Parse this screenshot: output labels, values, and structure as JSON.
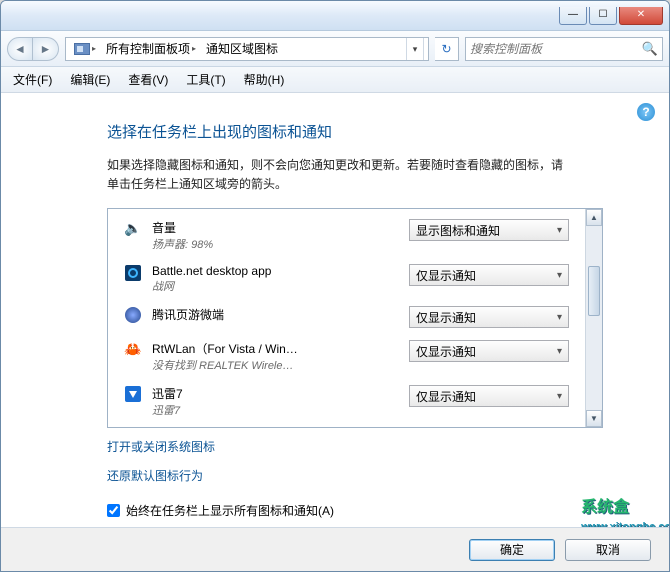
{
  "titlebar": {
    "title": ""
  },
  "breadcrumb": {
    "lvl1": "所有控制面板项",
    "lvl2": "通知区域图标"
  },
  "search": {
    "placeholder": "搜索控制面板"
  },
  "menu": {
    "file": "文件(F)",
    "edit": "编辑(E)",
    "view": "查看(V)",
    "tools": "工具(T)",
    "help": "帮助(H)"
  },
  "page": {
    "title": "选择在任务栏上出现的图标和通知",
    "desc": "如果选择隐藏图标和通知，则不会向您通知更改和更新。若要随时查看隐藏的图标，请单击任务栏上通知区域旁的箭头。"
  },
  "items": [
    {
      "name": "音量",
      "sub": "扬声器: 98%",
      "sel": "显示图标和通知"
    },
    {
      "name": "Battle.net desktop app",
      "sub": "战网",
      "sel": "仅显示通知"
    },
    {
      "name": "腾讯页游微端",
      "sub": "",
      "sel": "仅显示通知"
    },
    {
      "name": "RtWLan（For Vista / Win…",
      "sub": "没有找到 REALTEK Wirele…",
      "sel": "仅显示通知"
    },
    {
      "name": "迅雷7",
      "sub": "迅雷7",
      "sel": "仅显示通知"
    }
  ],
  "links": {
    "a": "打开或关闭系统图标",
    "b": "还原默认图标行为"
  },
  "checkbox": {
    "label": "始终在任务栏上显示所有图标和通知(A)",
    "checked": true
  },
  "buttons": {
    "ok": "确定",
    "cancel": "取消"
  },
  "watermark": {
    "title": "系统盒",
    "url": "www.xitonghe.com"
  }
}
